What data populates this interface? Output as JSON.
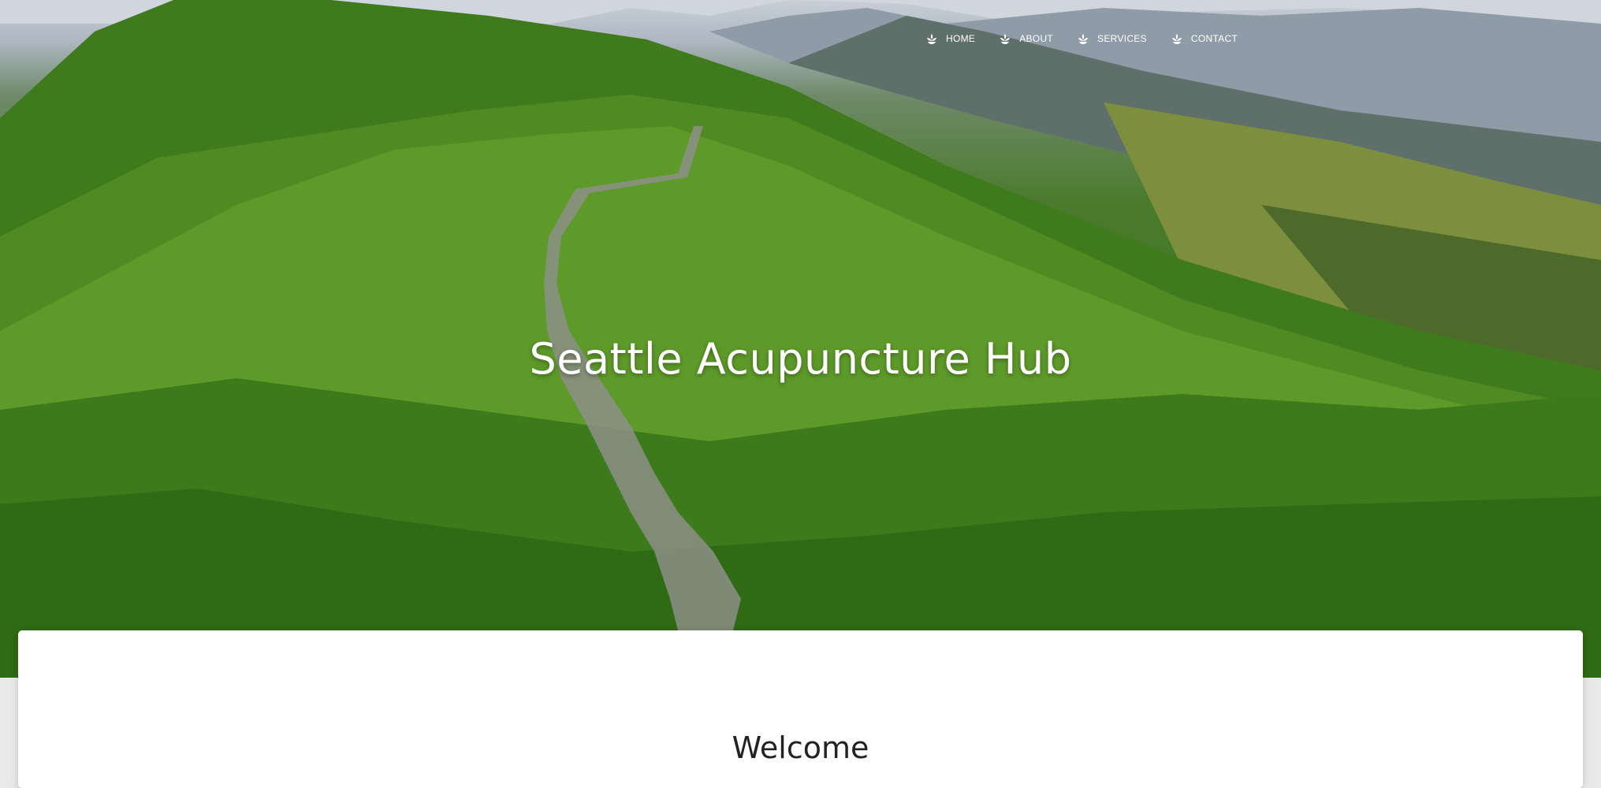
{
  "site": {
    "title": "Seattle Acupuncture Hub"
  },
  "nav": {
    "items": [
      {
        "label": "HOME",
        "icon": "lotus-icon"
      },
      {
        "label": "ABOUT",
        "icon": "lotus-icon"
      },
      {
        "label": "SERVICES",
        "icon": "lotus-icon"
      },
      {
        "label": "CONTACT",
        "icon": "lotus-icon"
      }
    ]
  },
  "content": {
    "heading": "Welcome"
  },
  "colors": {
    "nav_text": "#ffffff",
    "card_bg": "#ffffff",
    "page_bg": "#e9e9e9"
  }
}
